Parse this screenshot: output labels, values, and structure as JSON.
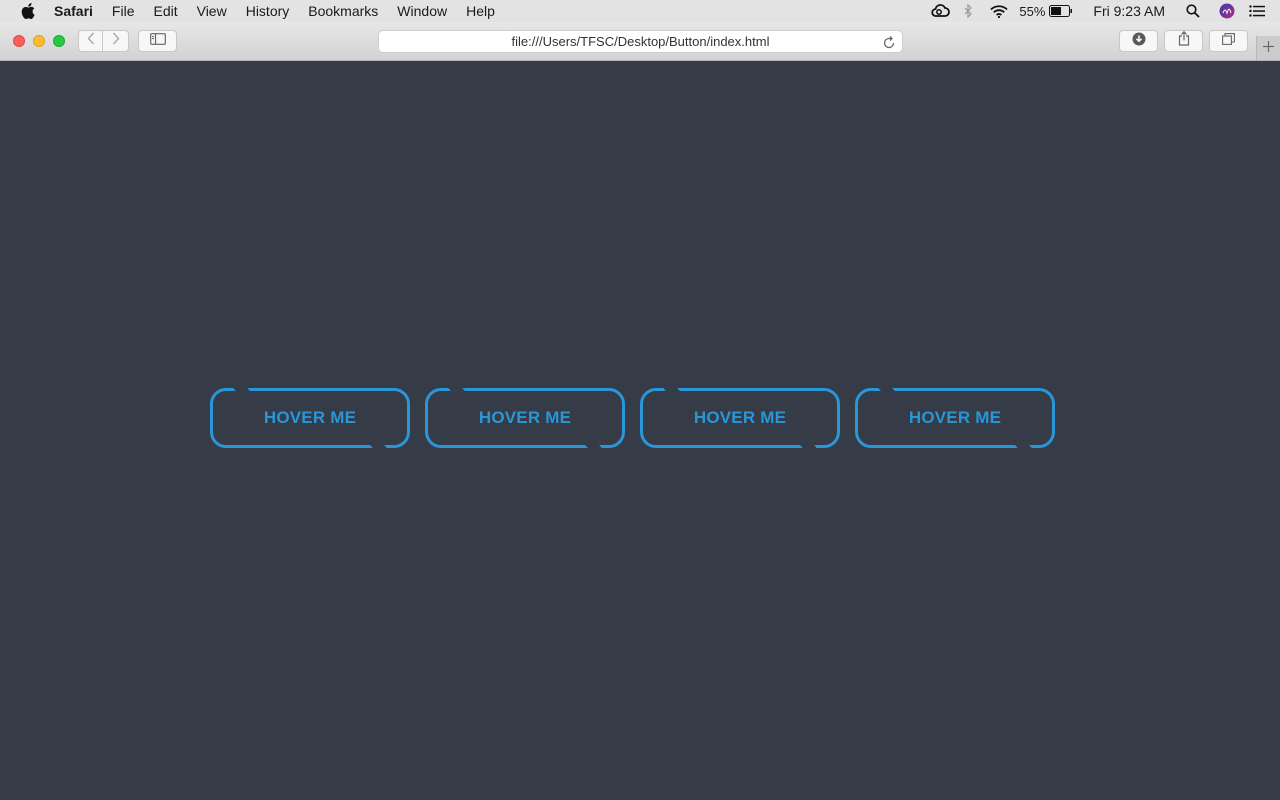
{
  "menubar": {
    "app_name": "Safari",
    "items": [
      "File",
      "Edit",
      "View",
      "History",
      "Bookmarks",
      "Window",
      "Help"
    ],
    "battery_percent": "55%",
    "clock": "Fri 9:23 AM"
  },
  "browser": {
    "url": "file:///Users/TFSC/Desktop/Button/index.html"
  },
  "buttons": [
    {
      "label": "HOVER ME"
    },
    {
      "label": "HOVER ME"
    },
    {
      "label": "HOVER ME"
    },
    {
      "label": "HOVER ME"
    }
  ],
  "colors": {
    "page_background": "#353b47",
    "button_accent": "#2996d8"
  },
  "icons": {
    "apple": "apple-logo-icon",
    "creative_cloud": "creative-cloud-icon",
    "bluetooth": "bluetooth-icon",
    "wifi": "wifi-icon",
    "battery": "battery-icon",
    "spotlight": "search-icon",
    "siri": "siri-icon",
    "notification_center": "list-icon",
    "back": "chevron-left-icon",
    "forward": "chevron-right-icon",
    "sidebar": "sidebar-icon",
    "reload": "reload-icon",
    "download": "download-icon",
    "share": "share-icon",
    "tabs": "tabs-icon",
    "new_tab": "plus-icon"
  }
}
